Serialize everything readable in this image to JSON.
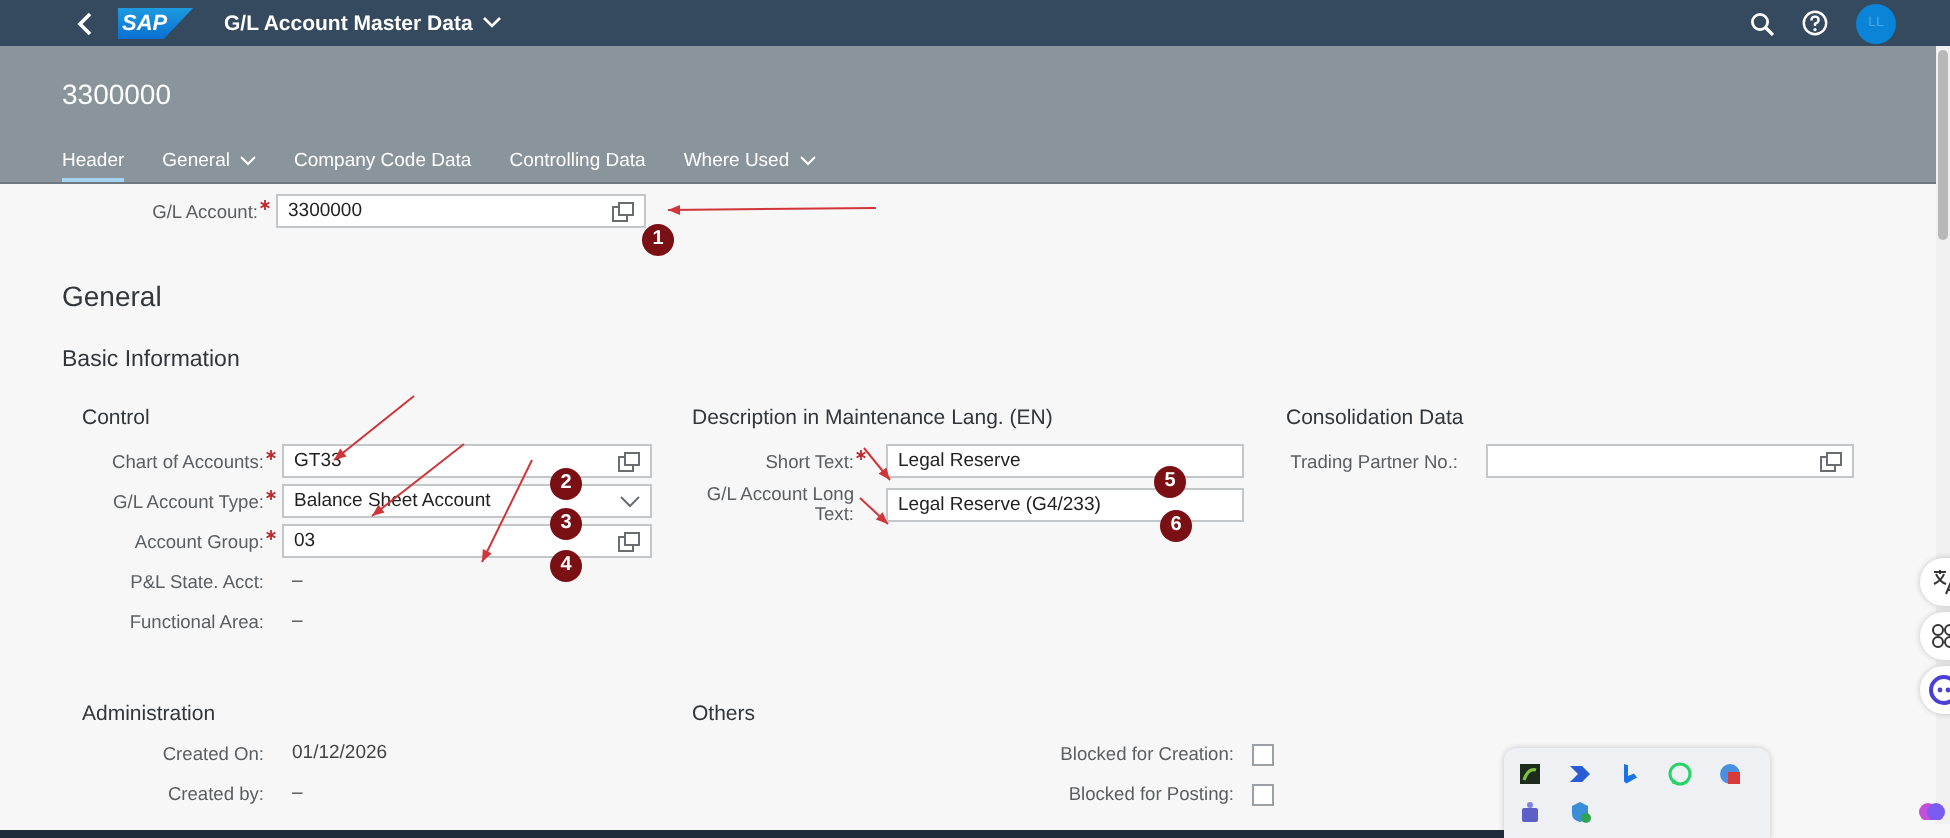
{
  "shell": {
    "logo": "SAP",
    "title": "G/L Account Master Data",
    "avatar": "LL"
  },
  "object": {
    "title": "3300000"
  },
  "tabs": [
    {
      "label": "Header",
      "selected": true,
      "menu": false
    },
    {
      "label": "General",
      "selected": false,
      "menu": true
    },
    {
      "label": "Company Code Data",
      "selected": false,
      "menu": false
    },
    {
      "label": "Controlling Data",
      "selected": false,
      "menu": false
    },
    {
      "label": "Where Used",
      "selected": false,
      "menu": true
    }
  ],
  "header_field": {
    "label": "G/L Account:",
    "required": true,
    "kind": "valuehelp",
    "value": "3300000"
  },
  "section": {
    "title": "General",
    "subtitle": "Basic Information"
  },
  "groups": [
    {
      "title": "Control",
      "fields": [
        {
          "label": "Chart of Accounts:",
          "required": true,
          "kind": "valuehelp",
          "value": "GT33"
        },
        {
          "label": "G/L Account Type:",
          "required": true,
          "kind": "select",
          "value": "Balance Sheet Account"
        },
        {
          "label": "Account Group:",
          "required": true,
          "kind": "valuehelp",
          "value": "03"
        },
        {
          "label": "P&L State. Acct:",
          "required": false,
          "kind": "text",
          "value": "–"
        },
        {
          "label": "Functional Area:",
          "required": false,
          "kind": "text",
          "value": "–"
        }
      ]
    },
    {
      "title": "Description in Maintenance Lang. (EN)",
      "fields": [
        {
          "label": "Short Text:",
          "required": true,
          "kind": "input",
          "value": "Legal Reserve"
        },
        {
          "label": "G/L Account Long Text:",
          "required": false,
          "kind": "input",
          "value": "Legal Reserve (G4/233)"
        }
      ]
    },
    {
      "title": "Consolidation Data",
      "fields": [
        {
          "label": "Trading Partner No.:",
          "required": false,
          "kind": "valuehelp"
        }
      ]
    }
  ],
  "groups2": [
    {
      "title": "Administration",
      "fields": [
        {
          "label": "Created On:",
          "required": false,
          "kind": "text",
          "value": "01/12/2026"
        },
        {
          "label": "Created by:",
          "required": false,
          "kind": "text",
          "value": "–"
        }
      ]
    },
    {
      "title": "Others",
      "fields": [
        {
          "label": "Blocked for Creation:",
          "required": false,
          "kind": "checkbox",
          "checked": false
        },
        {
          "label": "Blocked for Posting:",
          "required": false,
          "kind": "checkbox",
          "checked": false
        }
      ]
    }
  ],
  "annotations": [
    {
      "label": "1"
    },
    {
      "label": "2"
    },
    {
      "label": "3"
    },
    {
      "label": "4"
    },
    {
      "label": "5"
    },
    {
      "label": "6"
    }
  ]
}
